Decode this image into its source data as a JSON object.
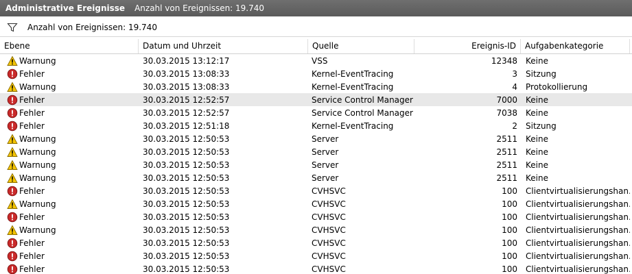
{
  "titlebar": {
    "title": "Administrative Ereignisse",
    "count_text": "Anzahl von Ereignissen: 19.740"
  },
  "filterbar": {
    "text": "Anzahl von Ereignissen: 19.740",
    "icon": "filter-icon"
  },
  "columns": {
    "level": "Ebene",
    "date": "Datum und Uhrzeit",
    "source": "Quelle",
    "event_id": "Ereignis-ID",
    "category": "Aufgabenkategorie"
  },
  "rows": [
    {
      "type": "warning",
      "level": "Warnung",
      "date": "30.03.2015 13:12:17",
      "source": "VSS",
      "id": "12348",
      "category": "Keine"
    },
    {
      "type": "error",
      "level": "Fehler",
      "date": "30.03.2015 13:08:33",
      "source": "Kernel-EventTracing",
      "id": "3",
      "category": "Sitzung"
    },
    {
      "type": "warning",
      "level": "Warnung",
      "date": "30.03.2015 13:08:33",
      "source": "Kernel-EventTracing",
      "id": "4",
      "category": "Protokollierung"
    },
    {
      "type": "error",
      "level": "Fehler",
      "date": "30.03.2015 12:52:57",
      "source": "Service Control Manager",
      "id": "7000",
      "category": "Keine",
      "selected": true
    },
    {
      "type": "error",
      "level": "Fehler",
      "date": "30.03.2015 12:52:57",
      "source": "Service Control Manager",
      "id": "7038",
      "category": "Keine"
    },
    {
      "type": "error",
      "level": "Fehler",
      "date": "30.03.2015 12:51:18",
      "source": "Kernel-EventTracing",
      "id": "2",
      "category": "Sitzung"
    },
    {
      "type": "warning",
      "level": "Warnung",
      "date": "30.03.2015 12:50:53",
      "source": "Server",
      "id": "2511",
      "category": "Keine"
    },
    {
      "type": "warning",
      "level": "Warnung",
      "date": "30.03.2015 12:50:53",
      "source": "Server",
      "id": "2511",
      "category": "Keine"
    },
    {
      "type": "warning",
      "level": "Warnung",
      "date": "30.03.2015 12:50:53",
      "source": "Server",
      "id": "2511",
      "category": "Keine"
    },
    {
      "type": "warning",
      "level": "Warnung",
      "date": "30.03.2015 12:50:53",
      "source": "Server",
      "id": "2511",
      "category": "Keine"
    },
    {
      "type": "error",
      "level": "Fehler",
      "date": "30.03.2015 12:50:53",
      "source": "CVHSVC",
      "id": "100",
      "category": "Clientvirtualisierungshan..."
    },
    {
      "type": "warning",
      "level": "Warnung",
      "date": "30.03.2015 12:50:53",
      "source": "CVHSVC",
      "id": "100",
      "category": "Clientvirtualisierungshan..."
    },
    {
      "type": "error",
      "level": "Fehler",
      "date": "30.03.2015 12:50:53",
      "source": "CVHSVC",
      "id": "100",
      "category": "Clientvirtualisierungshan..."
    },
    {
      "type": "warning",
      "level": "Warnung",
      "date": "30.03.2015 12:50:53",
      "source": "CVHSVC",
      "id": "100",
      "category": "Clientvirtualisierungshan..."
    },
    {
      "type": "error",
      "level": "Fehler",
      "date": "30.03.2015 12:50:53",
      "source": "CVHSVC",
      "id": "100",
      "category": "Clientvirtualisierungshan..."
    },
    {
      "type": "error",
      "level": "Fehler",
      "date": "30.03.2015 12:50:53",
      "source": "CVHSVC",
      "id": "100",
      "category": "Clientvirtualisierungshan..."
    },
    {
      "type": "error",
      "level": "Fehler",
      "date": "30.03.2015 12:50:53",
      "source": "CVHSVC",
      "id": "100",
      "category": "Clientvirtualisierungshan..."
    }
  ],
  "colors": {
    "titlebar": "#606060",
    "selected_row": "#e8e8e8",
    "error_icon": "#c62828",
    "warning_icon": "#f2c200"
  }
}
